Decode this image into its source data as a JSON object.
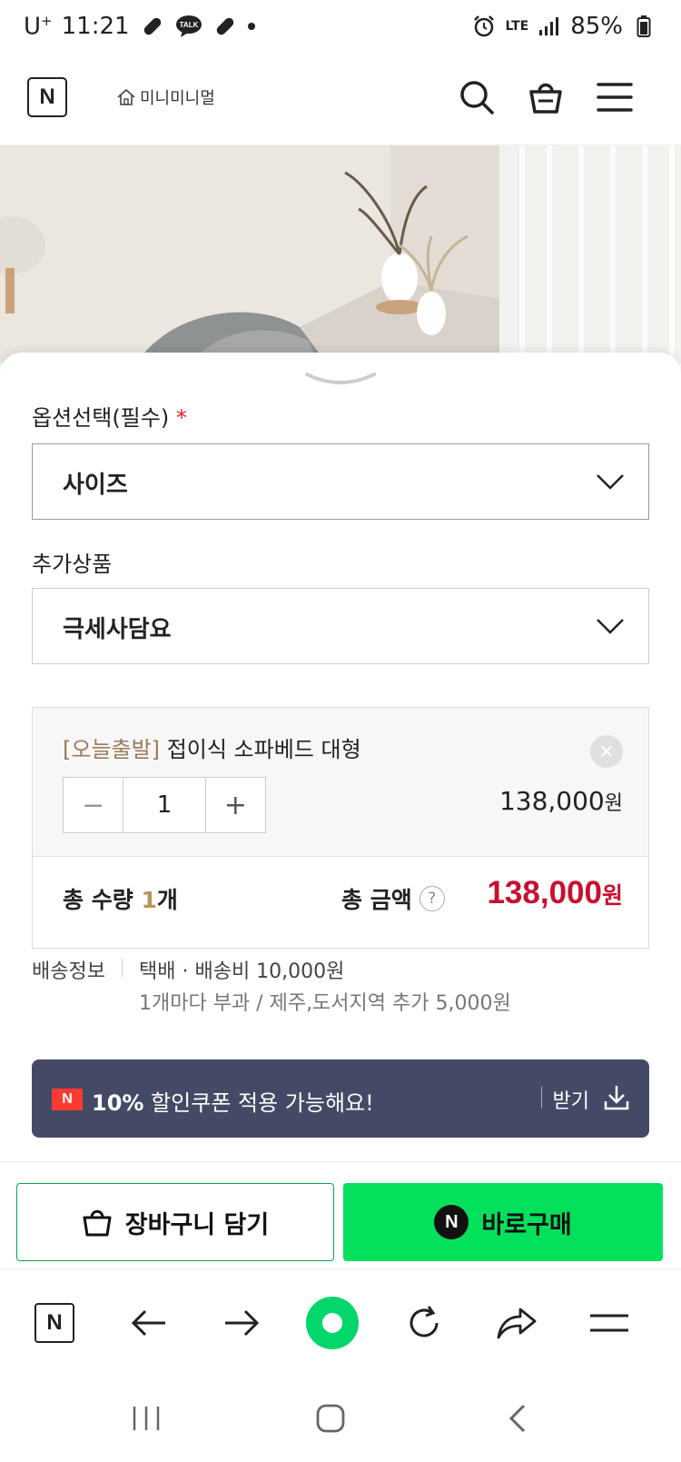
{
  "status_bar": {
    "carrier": "U",
    "carrier_sup": "+",
    "time": "11:21",
    "network": "LTE",
    "battery": "85%"
  },
  "header": {
    "logo": "N",
    "store_name": "미니미니멀"
  },
  "option": {
    "label": "옵션선택(필수)",
    "required_mark": "*",
    "select_value": "사이즈"
  },
  "addon": {
    "label": "추가상품",
    "select_value": "극세사담요"
  },
  "order_item": {
    "tag": "[오늘출발]",
    "name": "접이식 소파베드 대형",
    "quantity": "1",
    "minus": "−",
    "plus": "+",
    "price": "138,000",
    "currency": "원",
    "remove_glyph": "✕"
  },
  "totals": {
    "qty_label": "총 수량",
    "qty_value": "1",
    "qty_unit": "개",
    "amount_label": "총 금액",
    "help": "?",
    "amount": "138,000",
    "currency": "원"
  },
  "shipping": {
    "label": "배송정보",
    "main": "택배 · 배송비 10,000원",
    "sub": "1개마다 부과 / 제주,도서지역 추가 5,000원"
  },
  "coupon": {
    "badge": "N",
    "percent": "10%",
    "text": " 할인쿠폰 적용 가능해요!",
    "get_label": "받기"
  },
  "actions": {
    "cart_label": "장바구니 담기",
    "buy_label": "바로구매",
    "buy_badge": "N"
  },
  "browser_nav": {
    "logo": "N"
  },
  "colors": {
    "naver_green": "#03e05c",
    "price_red": "#c8102e",
    "coupon_bg": "#444a66",
    "tag_brown": "#9b7b5a"
  }
}
